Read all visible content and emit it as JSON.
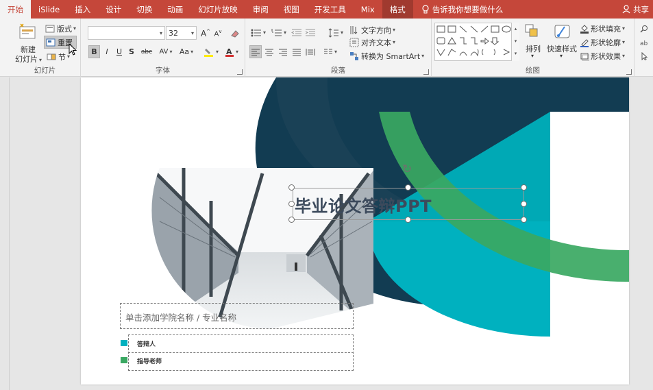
{
  "tabs": [
    {
      "label": "开始",
      "active": true
    },
    {
      "label": "iSlide"
    },
    {
      "label": "插入"
    },
    {
      "label": "设计"
    },
    {
      "label": "切换"
    },
    {
      "label": "动画"
    },
    {
      "label": "幻灯片放映"
    },
    {
      "label": "审阅"
    },
    {
      "label": "视图"
    },
    {
      "label": "开发工具"
    },
    {
      "label": "Mix"
    },
    {
      "label": "格式",
      "contextual": true
    }
  ],
  "tell_me": "告诉我你想要做什么",
  "share": "共享",
  "ribbon": {
    "slides": {
      "new_slide_line1": "新建",
      "new_slide_line2": "幻灯片",
      "layout": "版式",
      "reset": "重置",
      "section": "节",
      "group_label": "幻灯片"
    },
    "font": {
      "font_name": "",
      "font_size": "32",
      "bold": "B",
      "italic": "I",
      "underline": "U",
      "shadow": "S",
      "strike": "abc",
      "spacing": "AV",
      "case": "Aa",
      "group_label": "字体"
    },
    "paragraph": {
      "text_direction": "文字方向",
      "align_text": "对齐文本",
      "smartart": "转换为 SmartArt",
      "group_label": "段落"
    },
    "drawing": {
      "arrange": "排列",
      "quick_styles": "快速样式",
      "shape_fill": "形状填充",
      "shape_outline": "形状轮廓",
      "shape_effects": "形状效果",
      "group_label": "绘图"
    }
  },
  "slide": {
    "title": "毕业论文答辩PPT",
    "subtitle": "单击添加学院名称 / 专业名称",
    "presenter_label": "答辩人",
    "advisor_label": "指导老师"
  },
  "colors": {
    "ribbon_red": "#c5473a",
    "navy": "#123c52",
    "teal": "#00b1bf",
    "green": "#3aa862"
  }
}
